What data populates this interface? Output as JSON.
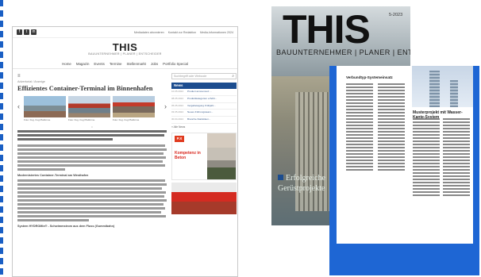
{
  "website": {
    "social_icons": [
      "f",
      "t",
      "in"
    ],
    "top_links": [
      "Mediadaten abonnieren",
      "Kontakt zur Redaktion",
      "Media-Informationen 2024"
    ],
    "logo": "THIS",
    "tagline": "BAUUNTERNEHMER | PLANER | ENTSCHEIDER",
    "nav": [
      "Home",
      "Magazin",
      "Events",
      "Termine",
      "Stellenmarkt",
      "Jobs",
      "Portfolio Special"
    ],
    "menu_icon": "≡",
    "kicker": "Advertorial / Anzeige",
    "article_title": "Effizientes Container-Terminal im Binnenhafen",
    "slides": [
      {
        "caption": "Foto: Fug. Fug Platforme"
      },
      {
        "caption": "Foto: Fug. Fug Platforme"
      },
      {
        "caption": "Foto: Fug. Fug Platforme"
      }
    ],
    "slider_prev": "‹",
    "slider_next": "›",
    "slider_dot": "•",
    "subheads": [
      "Modernisiertes Container-Terminal am Westhafen",
      "System HYDROMix® - Schwimmstrom aus dem Fluss (Gummibahn)"
    ],
    "search_placeholder": "Suchbegriff oder Webcode",
    "search_icon": "⌕",
    "news_header": "News",
    "news_items": [
      {
        "date": "10.05.2024",
        "text": "Product announced: ..."
      },
      {
        "date": "08.05.2024",
        "text": "Produktkategorien erhöht..."
      },
      {
        "date": "05.05.2024",
        "text": "Vergabetagung Frühjahr..."
      },
      {
        "date": "03.05.2024",
        "text": "Neues Führungsteam..."
      },
      {
        "date": "30.04.2024",
        "text": "Branche-Statistiken..."
      }
    ],
    "more_news": "» Alle News",
    "ad_logo": "P.X",
    "ad_text": "Kompetenz in Beton"
  },
  "magazine": {
    "logo": "THIS",
    "issue": "5-2023",
    "subline": "BAUUNTERNEHMER | PLANER | ENTSCHEIDER",
    "headline": [
      "Erfolgreiche",
      "Gerüstprojekte"
    ],
    "page_title_left": "Verbundtyp-Systemeinsatz",
    "page_title_right": "Musterprojekt mit Wasser-Kante-System"
  }
}
